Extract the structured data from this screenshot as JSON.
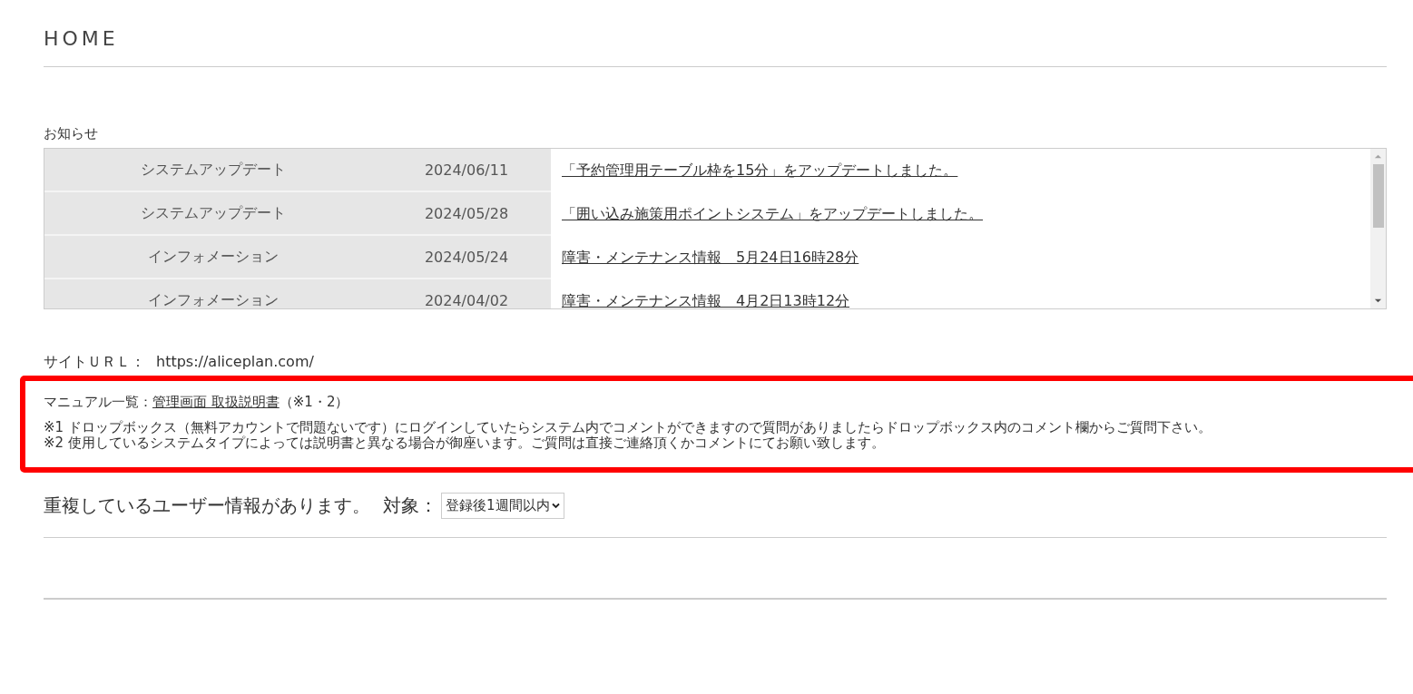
{
  "page_title": "HOME",
  "notices": {
    "heading": "お知らせ",
    "rows": [
      {
        "category": "システムアップデート",
        "date": "2024/06/11",
        "title": "「予約管理用テーブル枠を15分」をアップデートしました。"
      },
      {
        "category": "システムアップデート",
        "date": "2024/05/28",
        "title": "「囲い込み施策用ポイントシステム」をアップデートしました。"
      },
      {
        "category": "インフォメーション",
        "date": "2024/05/24",
        "title": "障害・メンテナンス情報　5月24日16時28分"
      },
      {
        "category": "インフォメーション",
        "date": "2024/04/02",
        "title": "障害・メンテナンス情報　4月2日13時12分"
      }
    ]
  },
  "site_url": {
    "label": "サイトＵＲＬ：",
    "url": "https://aliceplan.com/"
  },
  "manual": {
    "label": "マニュアル一覧：",
    "link": "管理画面 取扱説明書",
    "suffix": "（※1・2）",
    "notes": [
      "※1 ドロップボックス（無料アカウントで問題ないです）にログインしていたらシステム内でコメントができますので質問がありましたらドロップボックス内のコメント欄からご質問下さい。",
      "※2 使用しているシステムタイプによっては説明書と異なる場合が御座います。ご質問は直接ご連絡頂くかコメントにてお願い致します。"
    ]
  },
  "duplicates": {
    "message": "重複しているユーザー情報があります。",
    "target_label": "対象：",
    "select": {
      "value": "登録後1週間以内"
    }
  }
}
